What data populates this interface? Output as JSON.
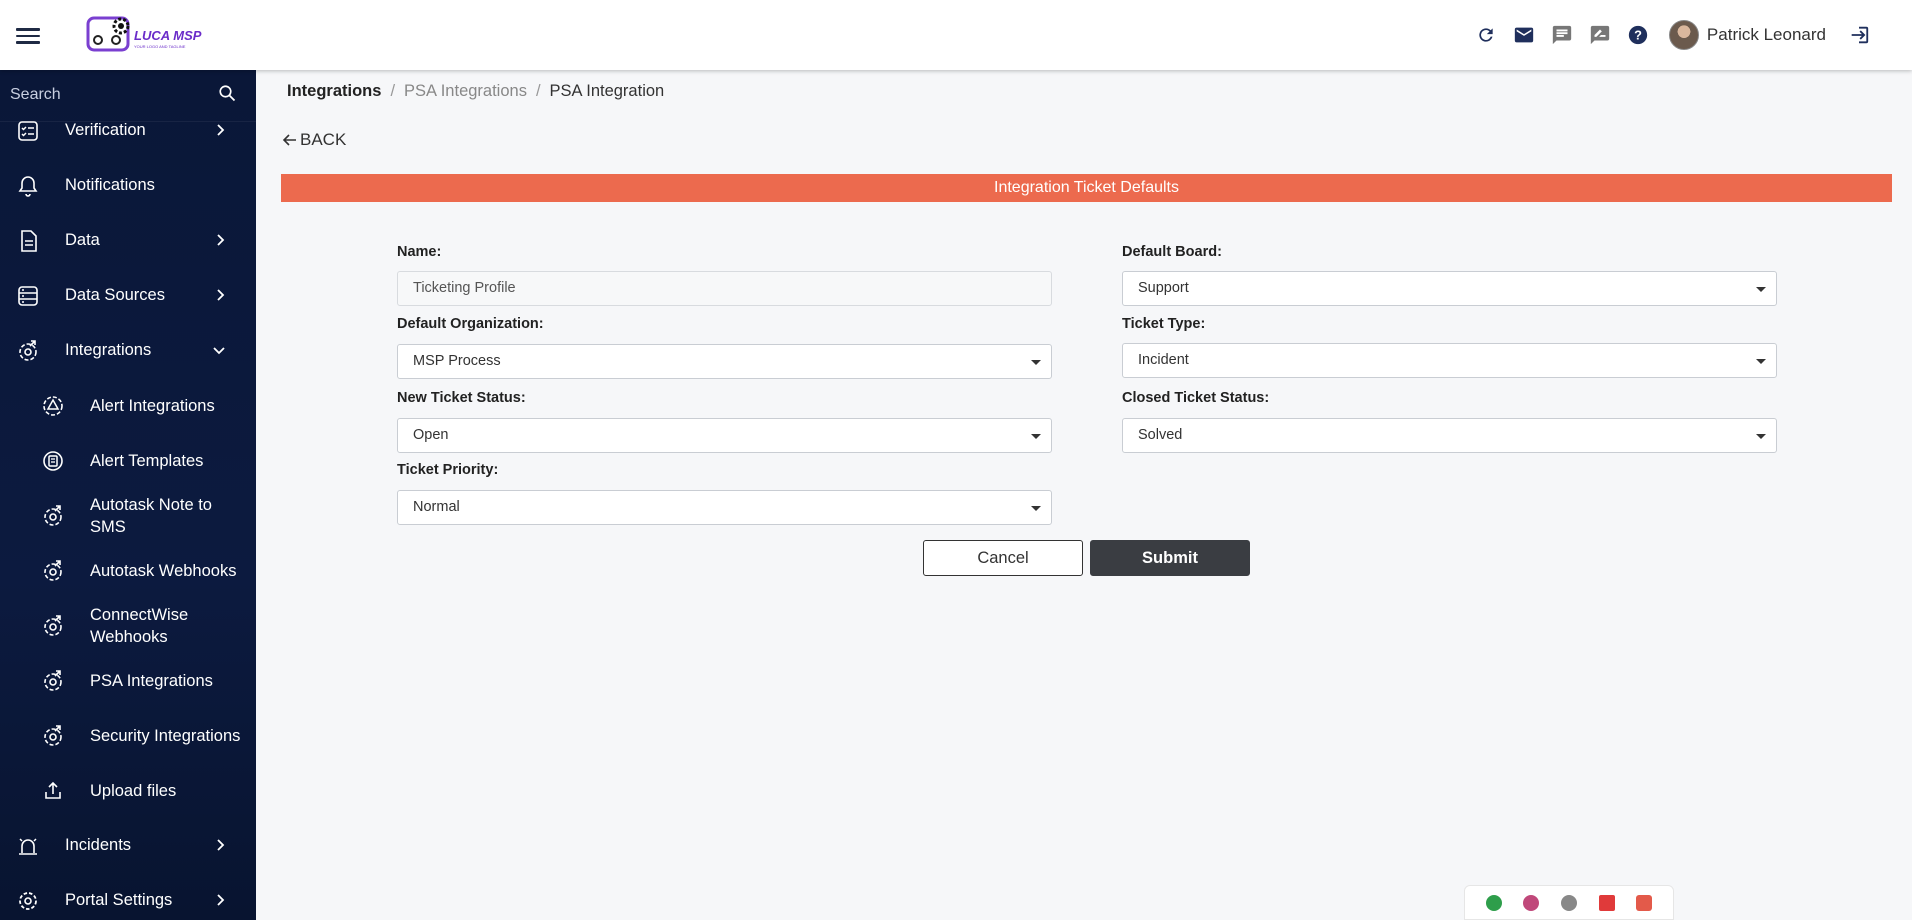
{
  "header": {
    "logo_text": "LUCA MSP",
    "logo_tagline": "YOUR LOGO AND TAGLINE",
    "user_name": "Patrick Leonard",
    "icons": [
      "refresh-icon",
      "mail-icon",
      "chat-icon",
      "feedback-icon",
      "help-icon",
      "logout-icon"
    ]
  },
  "sidebar": {
    "search_placeholder": "Search",
    "items": [
      {
        "label": "Verification",
        "icon": "checklist-icon",
        "expandable": true
      },
      {
        "label": "Notifications",
        "icon": "bell-icon",
        "expandable": false
      },
      {
        "label": "Data",
        "icon": "document-icon",
        "expandable": true
      },
      {
        "label": "Data Sources",
        "icon": "database-icon",
        "expandable": true
      },
      {
        "label": "Integrations",
        "icon": "gear-arrow-icon",
        "expandable": true,
        "expanded": true
      },
      {
        "label": "Alert Integrations",
        "icon": "alert-gear-icon",
        "sub": true
      },
      {
        "label": "Alert Templates",
        "icon": "template-icon",
        "sub": true
      },
      {
        "label": "Autotask Note to SMS",
        "line1": "Autotask Note to",
        "line2": "SMS",
        "icon": "gear-arrow-icon",
        "sub": true
      },
      {
        "label": "Autotask Webhooks",
        "icon": "gear-arrow-icon",
        "sub": true
      },
      {
        "label": "ConnectWise Webhooks",
        "line1": "ConnectWise",
        "line2": "Webhooks",
        "icon": "gear-arrow-icon",
        "sub": true
      },
      {
        "label": "PSA Integrations",
        "icon": "gear-arrow-icon",
        "sub": true
      },
      {
        "label": "Security Integrations",
        "icon": "gear-arrow-icon",
        "sub": true
      },
      {
        "label": "Upload files",
        "icon": "upload-icon",
        "sub": true
      },
      {
        "label": "Incidents",
        "icon": "alarm-icon",
        "expandable": true
      },
      {
        "label": "Portal Settings",
        "icon": "settings-icon",
        "expandable": true
      }
    ]
  },
  "breadcrumb": {
    "items": [
      "Integrations",
      "PSA Integrations",
      "PSA Integration"
    ],
    "separator": "/"
  },
  "back_label": "BACK",
  "banner_title": "Integration Ticket Defaults",
  "form": {
    "name_label": "Name:",
    "name_value": "Ticketing Profile",
    "default_board_label": "Default Board:",
    "default_board_value": "Support",
    "default_org_label": "Default Organization:",
    "default_org_value": "MSP Process",
    "ticket_type_label": "Ticket Type:",
    "ticket_type_value": "Incident",
    "new_status_label": "New Ticket Status:",
    "new_status_value": "Open",
    "closed_status_label": "Closed Ticket Status:",
    "closed_status_value": "Solved",
    "priority_label": "Ticket Priority:",
    "priority_value": "Normal"
  },
  "buttons": {
    "cancel": "Cancel",
    "submit": "Submit"
  },
  "colors": {
    "sidebar_bg": "#0a1738",
    "banner": "#ec6a4e",
    "submit_bg": "#3a3d42"
  }
}
